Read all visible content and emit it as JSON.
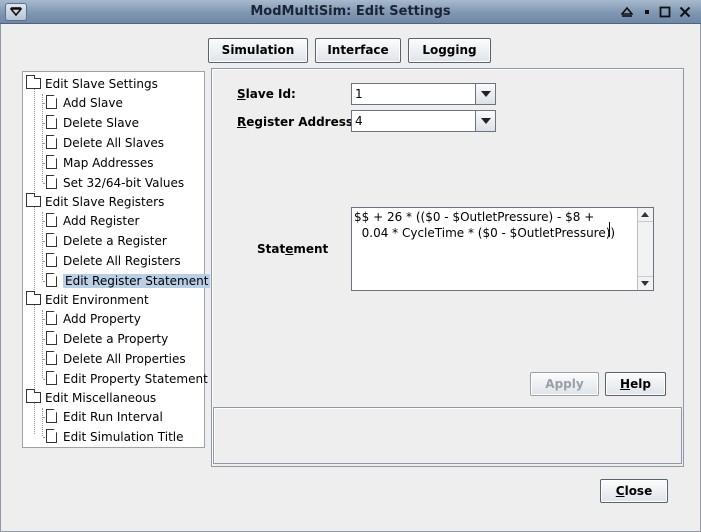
{
  "window": {
    "title": "ModMultiSim: Edit Settings",
    "menu_icon": "chevron-down-icon",
    "shade_icon": "shade-icon",
    "minimize_icon": "minimize-icon",
    "maximize_icon": "maximize-icon",
    "close_icon": "close-icon"
  },
  "top_tabs": [
    {
      "label": "Simulation"
    },
    {
      "label": "Interface"
    },
    {
      "label": "Logging"
    }
  ],
  "tree": {
    "groups": [
      {
        "label": "Edit Slave Settings",
        "items": [
          "Add Slave",
          "Delete Slave",
          "Delete All Slaves",
          "Map Addresses",
          "Set 32/64-bit Values"
        ]
      },
      {
        "label": "Edit Slave Registers",
        "items": [
          "Add Register",
          "Delete a Register",
          "Delete All Registers",
          "Edit Register Statement"
        ]
      },
      {
        "label": "Edit Environment",
        "items": [
          "Add Property",
          "Delete a Property",
          "Delete All Properties",
          "Edit Property Statement"
        ]
      },
      {
        "label": "Edit Miscellaneous",
        "items": [
          "Edit Run Interval",
          "Edit Simulation Title"
        ]
      }
    ],
    "selected": "Edit Register Statement"
  },
  "form": {
    "slave_id_label_pre": "",
    "slave_id_label_u": "S",
    "slave_id_label_post": "lave Id:",
    "slave_id_value": "1",
    "register_label_u": "R",
    "register_label_post": "egister Address:",
    "register_value": "4",
    "statement_label_pre": "Stat",
    "statement_label_u": "e",
    "statement_label_post": "ment",
    "statement_text": "$$ + 26 * (($0 - $OutletPressure) - $8 +\n  0.04 * CycleTime * ($0 - $OutletPressure))",
    "apply_label": "Apply",
    "help_label_u": "H",
    "help_label_post": "elp"
  },
  "footer": {
    "close_label_u": "C",
    "close_label_post": "lose"
  }
}
